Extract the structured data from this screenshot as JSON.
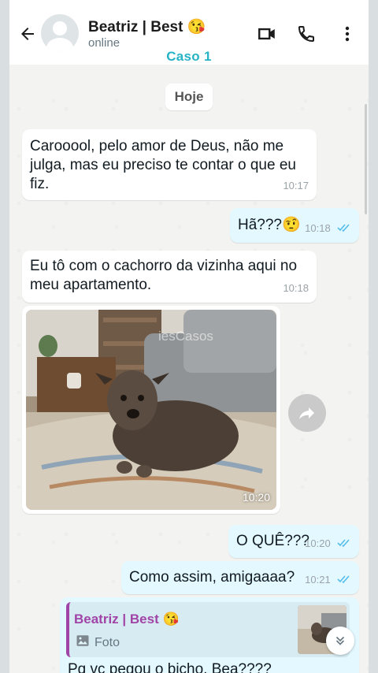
{
  "header": {
    "contact_name": "Beatriz | Best 😘",
    "status": "online",
    "case_label": "Caso 1",
    "icons": [
      "arrow-back-icon",
      "video-call-icon",
      "phone-icon",
      "more-vert-icon"
    ]
  },
  "date_separator": "Hoje",
  "messages": [
    {
      "direction": "in",
      "text": "Carooool, pelo amor de Deus, não me julga, mas eu preciso te contar o que eu fiz.",
      "time": "10:17"
    },
    {
      "direction": "out",
      "text": "Hã???🤨",
      "time": "10:18",
      "status": "read"
    },
    {
      "direction": "in",
      "text": "Eu tô com o cachorro da vizinha aqui no meu apartamento.",
      "time": "10:18"
    },
    {
      "direction": "in",
      "type": "photo",
      "caption_watermark": "iesCasos",
      "time": "10:20"
    },
    {
      "direction": "out",
      "text": "O QUÊ???",
      "time": "10:20",
      "status": "read"
    },
    {
      "direction": "out",
      "text": "Como assim, amigaaaa?",
      "time": "10:21",
      "status": "read"
    },
    {
      "direction": "out",
      "type": "reply",
      "quoted_author": "Beatriz | Best 😘",
      "quoted_label": "Foto",
      "text": "Pq vc pegou o bicho, Bea????"
    }
  ],
  "colors": {
    "incoming_bubble": "#ffffff",
    "outgoing_bubble": "#e3f8ff",
    "read_ticks": "#53bdeb",
    "case_label": "#26b3c6",
    "quote_author": "#a144a7"
  }
}
